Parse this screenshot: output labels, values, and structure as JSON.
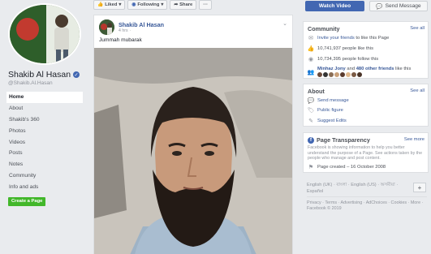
{
  "profile": {
    "name": "Shakib Al Hasan",
    "handle": "@Shakib.Al.Hasan"
  },
  "nav": {
    "items": [
      "Home",
      "About",
      "Shakib's 360",
      "Photos",
      "Videos",
      "Posts",
      "Notes",
      "Community",
      "Info and ads"
    ],
    "active_index": 0,
    "create_page_label": "Create a Page"
  },
  "actions": {
    "liked_label": "Liked",
    "following_label": "Following",
    "share_label": "Share",
    "more_label": "···",
    "watch_video_label": "Watch Video",
    "send_message_label": "Send Message"
  },
  "post": {
    "author": "Shakib Al Hasan",
    "time": "4 hrs",
    "text": "Jummah mubarak"
  },
  "community": {
    "title": "Community",
    "see_all": "See all",
    "invite_link": "Invite your friends",
    "invite_rest": " to like this Page",
    "likes": "10,741,937 people like this",
    "follows": "10,734,395 people follow this",
    "friends_prefix": "Minhaz Jony",
    "friends_mid": " and ",
    "friends_link": "480 other friends",
    "friends_suffix": " like this"
  },
  "about": {
    "title": "About",
    "see_all": "See all",
    "send_message": "Send message",
    "public_figure": "Public figure",
    "suggest_edits": "Suggest Edits"
  },
  "transparency": {
    "title": "Page Transparency",
    "see_more": "See more",
    "description": "Facebook is showing information to help you better understand the purpose of a Page. See actions taken by the people who manage and post content.",
    "created": "Page created – 16 October 2008"
  },
  "languages": {
    "text": "English (UK) · বাংলা · English (US) · অসমীয়া · Español",
    "plus": "+"
  },
  "footer": {
    "text": "Privacy · Terms · Advertising · AdChoices · Cookies · More ·",
    "copyright": "Facebook © 2019"
  },
  "colors": {
    "brand_blue": "#4267b2",
    "link_blue": "#385898",
    "create_green": "#42b72a",
    "background": "#e9ebee"
  }
}
